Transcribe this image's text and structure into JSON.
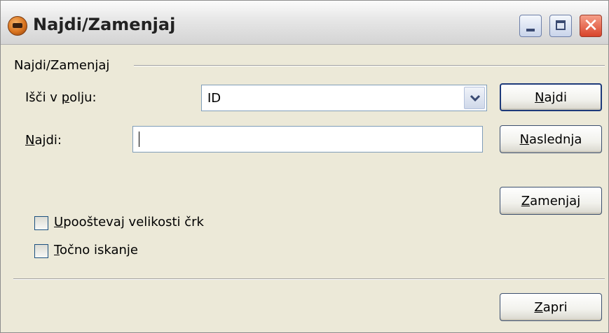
{
  "window": {
    "title": "Najdi/Zamenjaj"
  },
  "group": {
    "label": "Najdi/Zamenjaj"
  },
  "fields": {
    "search_in_label_pre": "Išči v ",
    "search_in_label_key": "p",
    "search_in_label_post": "olju:",
    "search_in_value": "ID",
    "find_label_key": "N",
    "find_label_post": "ajdi:",
    "find_value": ""
  },
  "buttons": {
    "find_key": "N",
    "find_rest": "ajdi",
    "next_key": "N",
    "next_rest": "aslednja",
    "replace_key": "Z",
    "replace_rest": "amenjaj",
    "close_key": "Z",
    "close_rest": "apri"
  },
  "options": {
    "match_case_key": "U",
    "match_case_rest": "pooštevaj velikosti črk",
    "exact_key": "T",
    "exact_rest": "očno iskanje",
    "match_case_checked": false,
    "exact_checked": false
  },
  "icons": {
    "app": "app-icon",
    "minimize": "minimize-icon",
    "maximize": "maximize-icon",
    "close": "close-icon",
    "dropdown": "chevron-down-icon"
  },
  "colors": {
    "window_bg": "#ece9d8",
    "close_button": "#d8432a",
    "field_border": "#7f9db9"
  }
}
